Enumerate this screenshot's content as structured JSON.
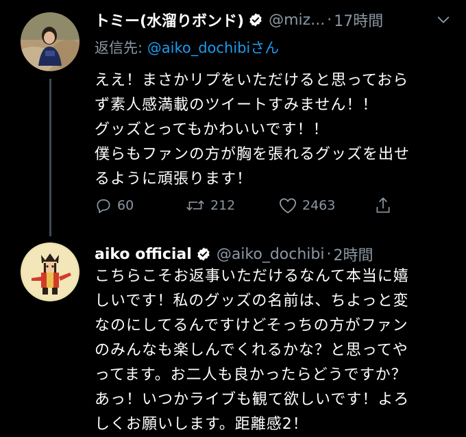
{
  "tweets": [
    {
      "name": "トミー(水溜りボンド)",
      "handle": "@miz...",
      "time": "17時間",
      "reply_label": "返信先:",
      "reply_to": "@aiko_dochibi",
      "reply_suffix": "さん",
      "lines": [
        "ええ！まさかリプをいただけると思っておら",
        "ず素人感満載のツイートすみません！！",
        "グッズとってもかわいいです！！",
        "僕らもファンの方が胸を張れるグッズを出せ",
        "るように頑張ります！"
      ],
      "replies": "60",
      "retweets": "212",
      "likes": "2463"
    },
    {
      "name": "aiko official",
      "handle": "@aiko_dochibi",
      "time": "2時間",
      "lines": [
        "こちらこそお返事いただけるなんて本当に嬉",
        "しいです！私のグッズの名前は、ちよっと変",
        "なのにしてるんですけどそっちの方がファン",
        "のみんなも楽しんでくれるかな？と思ってや",
        "ってます。お二人も良かったらどうですか？",
        "あっ！いつかライブも観て欲しいです！よろ",
        "しくお願いします。距離感2！"
      ]
    }
  ],
  "icons": {
    "verified": "verified-badge-icon",
    "more": "chevron-down-icon",
    "reply": "reply-icon",
    "retweet": "retweet-icon",
    "like": "heart-icon",
    "share": "share-icon"
  },
  "colors": {
    "background": "#000000",
    "secondary_text": "#8b98a5",
    "link": "#1d9bf0",
    "thread_line": "#3d4a56"
  }
}
